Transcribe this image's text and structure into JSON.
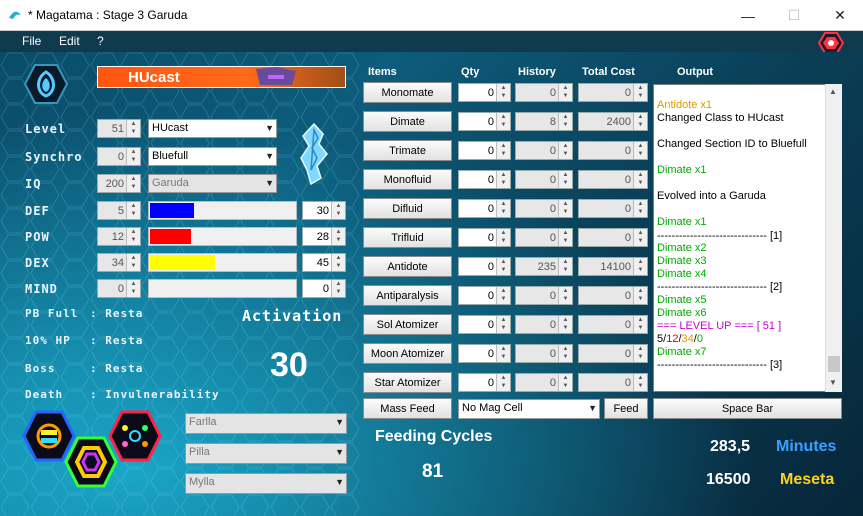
{
  "window": {
    "title": "* Magatama : Stage 3 Garuda",
    "min": "—",
    "max": "☐",
    "close": "✕"
  },
  "menu": {
    "file": "File",
    "edit": "Edit",
    "help": "?"
  },
  "char": {
    "name": "HUcast"
  },
  "left": {
    "level_label": "Level",
    "level_value": "51",
    "class": "HUcast",
    "synchro_label": "Synchro",
    "synchro_value": "0",
    "section_id": "Bluefull",
    "iq_label": "IQ",
    "iq_value": "200",
    "form": "Garuda",
    "stats": [
      {
        "label": "DEF",
        "value": "5",
        "max": "30",
        "color": "#0000ff",
        "fill": 0.3
      },
      {
        "label": "POW",
        "value": "12",
        "max": "28",
        "color": "#ff0000",
        "fill": 0.28
      },
      {
        "label": "DEX",
        "value": "34",
        "max": "45",
        "color": "#ffff00",
        "fill": 0.45
      },
      {
        "label": "MIND",
        "value": "0",
        "max": "0",
        "color": "#ffffff",
        "fill": 0
      }
    ],
    "triggers": [
      {
        "label": "PB Full",
        "value": ": Resta"
      },
      {
        "label": "10% HP",
        "value": ": Resta"
      },
      {
        "label": "Boss",
        "value": ": Resta"
      },
      {
        "label": "Death",
        "value": ": Invulnerability"
      }
    ],
    "activation_label": "Activation",
    "activation_value": "30",
    "pbs": [
      "Farlla",
      "Pilla",
      "Mylla"
    ]
  },
  "table": {
    "headers": {
      "items": "Items",
      "qty": "Qty",
      "history": "History",
      "total_cost": "Total Cost",
      "output": "Output"
    },
    "rows": [
      {
        "item": "Monomate",
        "qty": "0",
        "history": "0",
        "cost": "0"
      },
      {
        "item": "Dimate",
        "qty": "0",
        "history": "8",
        "cost": "2400"
      },
      {
        "item": "Trimate",
        "qty": "0",
        "history": "0",
        "cost": "0"
      },
      {
        "item": "Monofluid",
        "qty": "0",
        "history": "0",
        "cost": "0"
      },
      {
        "item": "Difluid",
        "qty": "0",
        "history": "0",
        "cost": "0"
      },
      {
        "item": "Trifluid",
        "qty": "0",
        "history": "0",
        "cost": "0"
      },
      {
        "item": "Antidote",
        "qty": "0",
        "history": "235",
        "cost": "14100"
      },
      {
        "item": "Antiparalysis",
        "qty": "0",
        "history": "0",
        "cost": "0"
      },
      {
        "item": "Sol Atomizer",
        "qty": "0",
        "history": "0",
        "cost": "0"
      },
      {
        "item": "Moon Atomizer",
        "qty": "0",
        "history": "0",
        "cost": "0"
      },
      {
        "item": "Star Atomizer",
        "qty": "0",
        "history": "0",
        "cost": "0"
      }
    ]
  },
  "bottom": {
    "mass_feed": "Mass Feed",
    "mag_cell": "No Mag Cell",
    "feed": "Feed",
    "space_bar": "Space Bar",
    "feeding_cycles_label": "Feeding Cycles",
    "feeding_cycles_value": "81",
    "minutes_value": "283,5",
    "minutes_label": "Minutes",
    "meseta_value": "16500",
    "meseta_label": "Meseta"
  },
  "log": [
    {
      "text": "Antidote x1",
      "color": "#d99a00"
    },
    {
      "text": "Changed Class to HUcast",
      "color": "#000000"
    },
    {
      "text": "Changed Section ID to Bluefull",
      "color": "#000000"
    },
    {
      "text": "Dimate x1",
      "color": "#00aa00"
    },
    {
      "text": "Evolved into a Garuda",
      "color": "#000000"
    },
    {
      "text": "Dimate x1",
      "color": "#00aa00"
    },
    {
      "text": "------------------------------ [1]",
      "color": "#000000"
    },
    {
      "text": "Dimate x2",
      "color": "#00aa00"
    },
    {
      "text": "Dimate x3",
      "color": "#00aa00"
    },
    {
      "text": "Dimate x4",
      "color": "#00aa00"
    },
    {
      "text": "------------------------------ [2]",
      "color": "#000000"
    },
    {
      "text": "Dimate x5",
      "color": "#00aa00"
    },
    {
      "text": "Dimate x6",
      "color": "#00aa00"
    },
    {
      "text": "=== LEVEL UP === [ 51 ]",
      "color": "#cc00cc"
    },
    {
      "text": "5/12/34/0",
      "color": "#000000"
    },
    {
      "text": "Dimate x7",
      "color": "#00aa00"
    },
    {
      "text": "------------------------------ [3]",
      "color": "#000000"
    }
  ]
}
